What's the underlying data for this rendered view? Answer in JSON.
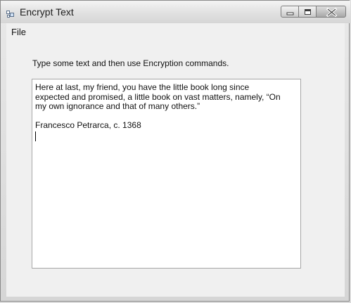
{
  "window": {
    "title": "Encrypt Text"
  },
  "menu": {
    "file_label": "File"
  },
  "instructions": "Type some text and then use Encryption commands.",
  "textbox": {
    "lines": [
      "Here at last, my friend, you have the little book long since",
      "expected and promised, a little book on vast matters, namely, “On",
      "my own ignorance and that of many others.”",
      "",
      "Francesco Petrarca, c. 1368"
    ]
  },
  "icons": {
    "app": "app-window-icon",
    "minimize": "minimize-icon",
    "maximize": "maximize-icon",
    "close": "close-icon"
  },
  "colors": {
    "window_frame": "#dcdcdc",
    "client_background": "#f0f0f0",
    "textbox_background": "#ffffff",
    "text": "#111111"
  }
}
